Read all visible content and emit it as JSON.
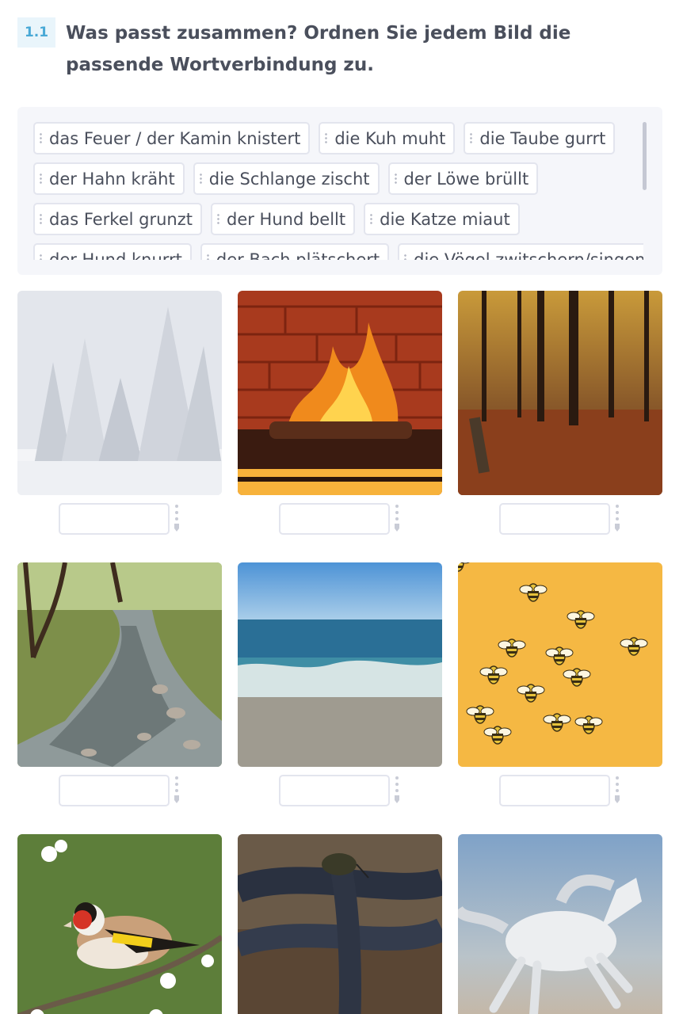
{
  "task": {
    "number": "1.1",
    "title": "Was passt zusammen? Ordnen Sie jedem Bild die passende Wortverbindung zu."
  },
  "word_bank": {
    "rows": [
      [
        "das Feuer / der Kamin knistert",
        "die Kuh muht",
        "die Taube gurrt"
      ],
      [
        "der Hahn kräht",
        "die Schlange zischt",
        "der Löwe brüllt"
      ],
      [
        "das Ferkel grunzt",
        "der Hund bellt",
        "die Katze miaut"
      ],
      [
        "der Hund knurrt",
        "der Bach plätschert",
        "die Vögel zwitschern/singen"
      ]
    ]
  },
  "images": [
    {
      "subject": "snowy-forest",
      "answer": ""
    },
    {
      "subject": "fireplace",
      "answer": ""
    },
    {
      "subject": "autumn-forest",
      "answer": ""
    },
    {
      "subject": "stream",
      "answer": ""
    },
    {
      "subject": "sea",
      "answer": ""
    },
    {
      "subject": "bees",
      "answer": ""
    },
    {
      "subject": "goldfinch-bird",
      "answer": ""
    },
    {
      "subject": "snake",
      "answer": ""
    },
    {
      "subject": "white-horse",
      "answer": ""
    }
  ],
  "colors": {
    "accent": "#49a9d6",
    "text": "#4a4f5c",
    "chip_border": "#e3e5ee",
    "bank_bg": "#f5f6fa"
  }
}
